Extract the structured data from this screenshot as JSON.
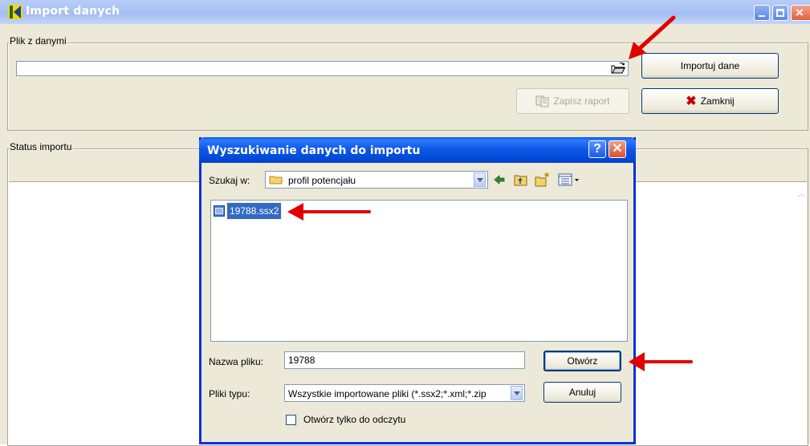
{
  "main_window": {
    "title": "Import danych",
    "file_group_label": "Plik z danymi",
    "file_path_value": "",
    "import_button_label": "Importuj dane",
    "save_report_label": "Zapisz raport",
    "close_button_label": "Zamknij",
    "status_group_label": "Status importu"
  },
  "dialog": {
    "title": "Wyszukiwanie danych do importu",
    "help_label": "?",
    "look_in_label": "Szukaj w:",
    "look_in_value": "profil potencjału",
    "files": [
      "19788.ssx2"
    ],
    "file_name_label": "Nazwa pliku:",
    "file_name_value": "19788",
    "file_type_label": "Pliki typu:",
    "file_type_value": "Wszystkie importowane pliki (*.ssx2;*.xml;*.zip",
    "open_label": "Otwórz",
    "cancel_label": "Anuluj",
    "readonly_label": "Otwórz tylko do odczytu"
  },
  "colors": {
    "annotation_arrow": "#e10000",
    "selection": "#316ac5",
    "dialog_title": "#0046d5"
  }
}
